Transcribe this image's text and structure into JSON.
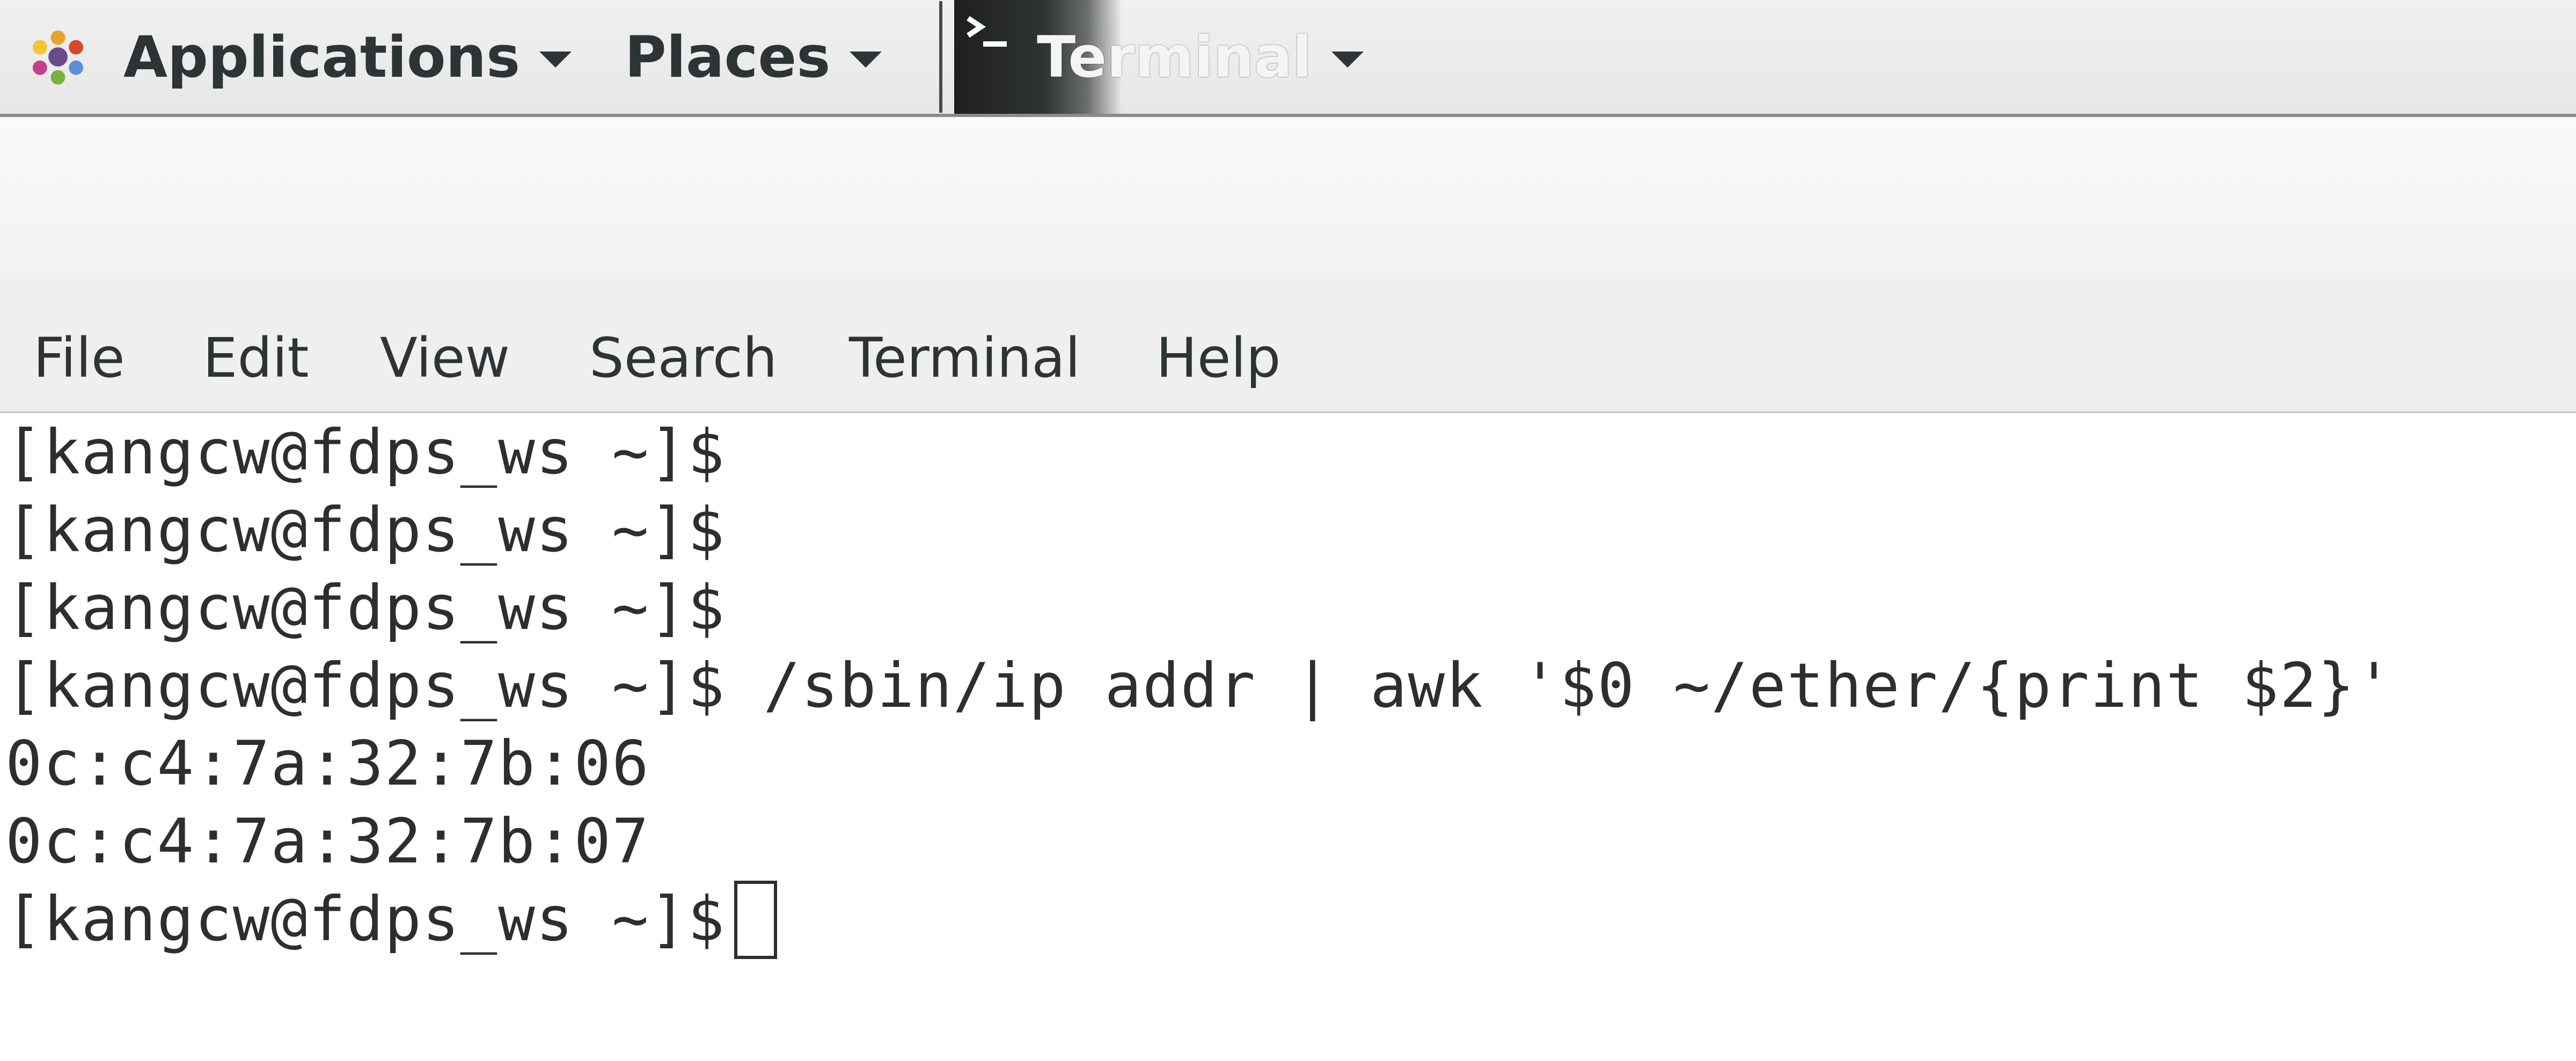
{
  "top_panel": {
    "applications_label": "Applications",
    "places_label": "Places",
    "active_task_label": "Terminal",
    "icons": {
      "applications": "gnome-foot-icon",
      "terminal": "terminal-app-icon",
      "dropdown": "chevron-down-icon"
    }
  },
  "menubar": {
    "items": [
      "File",
      "Edit",
      "View",
      "Search",
      "Terminal",
      "Help"
    ]
  },
  "terminal": {
    "prompt": "[kangcw@fdps_ws ~]$",
    "lines": [
      "[kangcw@fdps_ws ~]$",
      "[kangcw@fdps_ws ~]$",
      "[kangcw@fdps_ws ~]$",
      "[kangcw@fdps_ws ~]$ /sbin/ip addr | awk '$0 ~/ether/{print $2}'",
      "0c:c4:7a:32:7b:06",
      "0c:c4:7a:32:7b:07"
    ]
  },
  "colors": {
    "panel_bg": "#ececec",
    "panel_text": "#2e3436",
    "menubar_bg": "#efefef",
    "terminal_bg": "#ffffff",
    "terminal_text": "#2e2e2e"
  }
}
